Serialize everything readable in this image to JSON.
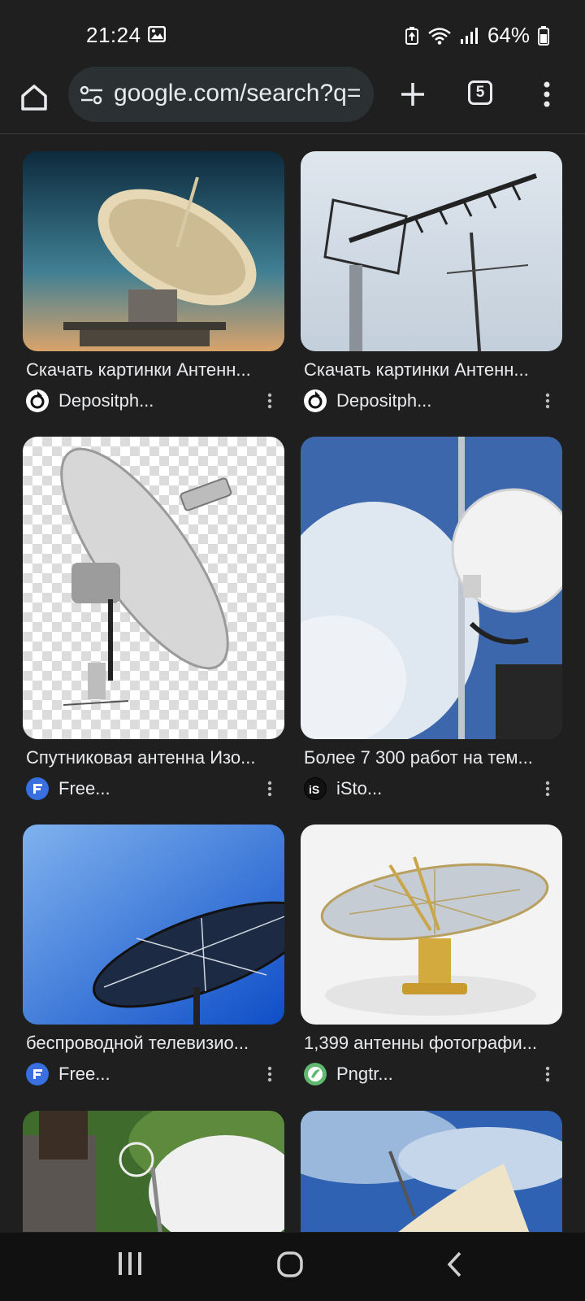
{
  "status_bar": {
    "time": "21:24",
    "battery": "64%"
  },
  "toolbar": {
    "url": "google.com/search?q=",
    "tab_count": "5"
  },
  "results": [
    {
      "title": "Скачать картинки Антенн...",
      "source": "Depositph...",
      "favicon": "depositphotos-icon"
    },
    {
      "title": "Скачать картинки Антенн...",
      "source": "Depositph...",
      "favicon": "depositphotos-icon"
    },
    {
      "title": "Спутниковая антенна Изо...",
      "source": "Free...",
      "favicon": "freepik-icon"
    },
    {
      "title": "Более 7 300 работ на тем...",
      "source": "iSto...",
      "favicon": "istock-icon"
    },
    {
      "title": "беспроводной телевизио...",
      "source": "Free...",
      "favicon": "freepik-icon"
    },
    {
      "title": "1,399 антенны фотографи...",
      "source": "Pngtr...",
      "favicon": "pngtree-icon"
    }
  ],
  "colors": {
    "background": "#1f1f1f",
    "omnibox": "#2b3133",
    "text": "#e8eaed"
  }
}
